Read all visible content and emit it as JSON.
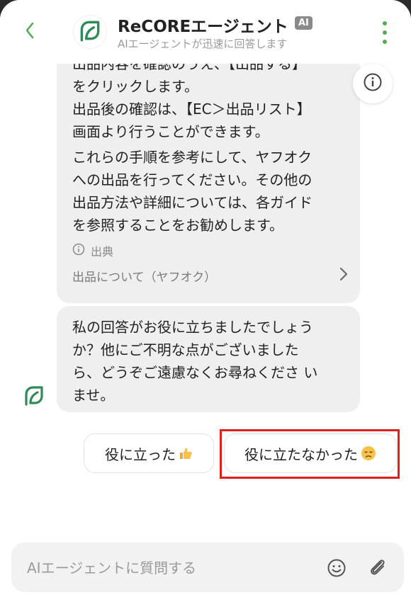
{
  "header": {
    "agent_name": "ReCOREエージェント",
    "badge": "AI",
    "subtitle": "AIエージェントが迅速に回答します"
  },
  "messages": [
    {
      "sender": "agent",
      "text_top": "出品内容を確認のうえ、【出品する】\nをクリックします。\n出品後の確認は、【EC＞出品リスト】\n画面より行うことができます。",
      "text_bottom": "これらの手順を参考にして、ヤフオク\nへの出品を行ってください。その他の\n出品方法や詳細については、各ガイド\nを参照することをお勧めします。",
      "source_label": "出典",
      "source_link": "出品について（ヤフオク）"
    },
    {
      "sender": "agent",
      "text": "私の回答がお役に立ちましたでしょう\nか？他にご不明な点がございました\nら、どうぞご遠慮なくお尋ねくださ い\nませ。"
    }
  ],
  "feedback": {
    "helpful_label": "役に立った",
    "not_helpful_label": "役に立たなかった"
  },
  "input": {
    "placeholder": "AIエージェントに質問する",
    "value": ""
  },
  "colors": {
    "brand_green": "#2e8b57",
    "accent_green": "#4caf50",
    "highlight_red": "#e0201c"
  },
  "icons": {
    "back": "chevron-left-icon",
    "menu": "more-vertical-icon",
    "info": "info-icon",
    "source": "info-small-icon",
    "link": "chevron-right-icon",
    "emoji": "smiley-icon",
    "attach": "paperclip-icon",
    "helpful": "thumbs-up-emoji",
    "not_helpful": "disappointed-emoji"
  }
}
